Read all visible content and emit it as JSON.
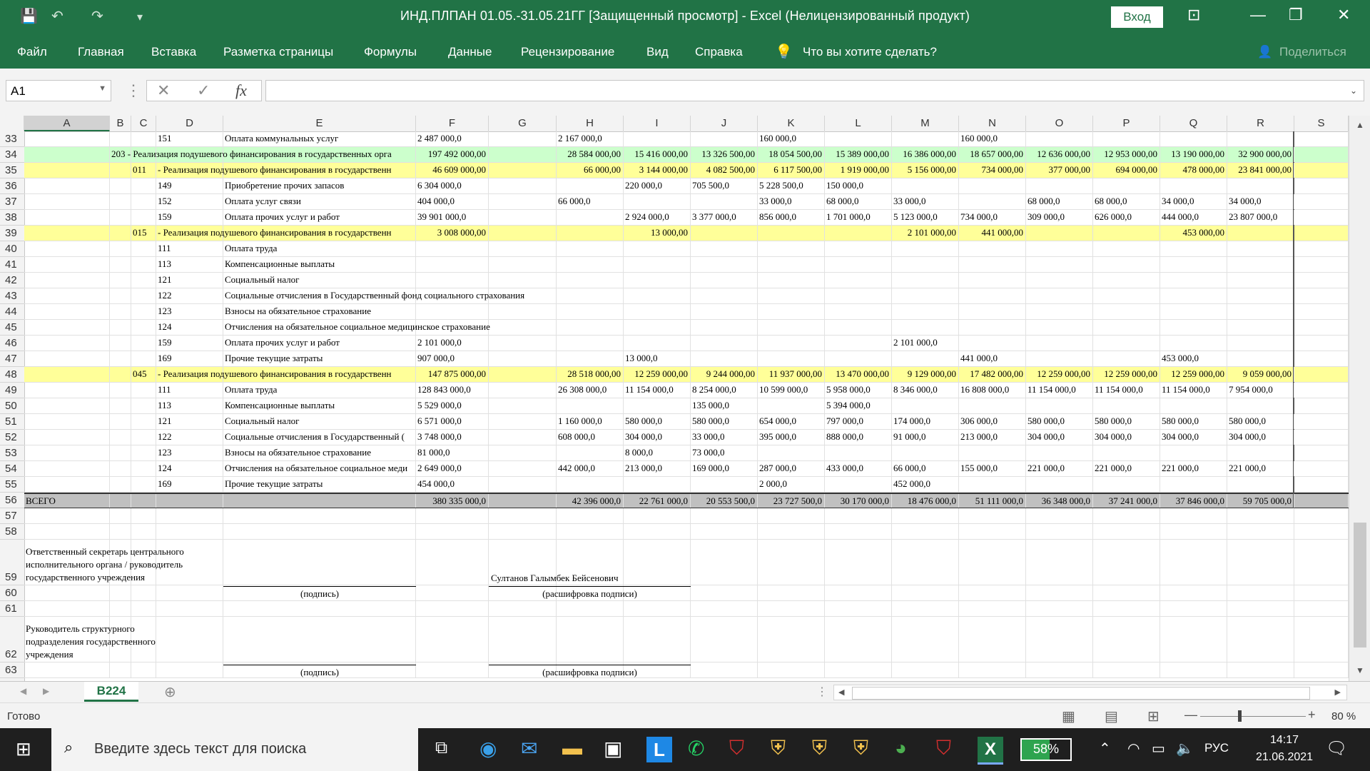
{
  "window": {
    "title": "ИНД.ПЛПАН 01.05.-31.05.21ГГ  [Защищенный просмотр]  -  Excel (Нелицензированный продукт)",
    "login_label": "Вход"
  },
  "ribbon": {
    "tabs": [
      "Файл",
      "Главная",
      "Вставка",
      "Разметка страницы",
      "Формулы",
      "Данные",
      "Рецензирование",
      "Вид",
      "Справка"
    ],
    "tell_me": "Что вы хотите сделать?",
    "share": "Поделиться"
  },
  "formula_bar": {
    "name_box": "A1",
    "fx": "fx",
    "value": ""
  },
  "columns": [
    "A",
    "B",
    "C",
    "D",
    "E",
    "F",
    "G",
    "H",
    "I",
    "J",
    "K",
    "L",
    "M",
    "N",
    "O",
    "P",
    "Q",
    "R",
    "S"
  ],
  "rows": [
    {
      "n": "33",
      "d": "151",
      "e": "Оплата коммунальных услуг",
      "f": "2 487 000,0",
      "h": "2 167 000,0",
      "k": "160 000,0",
      "n2": "160 000,0"
    },
    {
      "n": "34",
      "style": "green",
      "b": "203 - Реализация подушевого финансирования в государственных орга",
      "f": "197 492 000,00",
      "h": "28 584 000,00",
      "i": "15 416 000,00",
      "j": "13 326 500,00",
      "k": "18 054 500,00",
      "l": "15 389 000,00",
      "m": "16 386 000,00",
      "n2": "18 657 000,00",
      "o": "12 636 000,00",
      "p": "12 953 000,00",
      "q": "13 190 000,00",
      "r": "32 900 000,00"
    },
    {
      "n": "35",
      "style": "yellow",
      "c": "011",
      "d": "- Реализация подушевого финансирования в государственн",
      "f": "46 609 000,00",
      "h": "66 000,00",
      "i": "3 144 000,00",
      "j": "4 082 500,00",
      "k": "6 117 500,00",
      "l": "1 919 000,00",
      "m": "5 156 000,00",
      "n2": "734 000,00",
      "o": "377 000,00",
      "p": "694 000,00",
      "q": "478 000,00",
      "r": "23 841 000,00"
    },
    {
      "n": "36",
      "d": "149",
      "e": "Приобретение прочих запасов",
      "f": "6 304 000,0",
      "i": "220 000,0",
      "j": "705 500,0",
      "k": "5 228 500,0",
      "l": "150 000,0"
    },
    {
      "n": "37",
      "d": "152",
      "e": "Оплата услуг связи",
      "f": "404 000,0",
      "h": "66 000,0",
      "k": "33 000,0",
      "l": "68 000,0",
      "m": "33 000,0",
      "o": "68 000,0",
      "p": "68 000,0",
      "q": "34 000,0",
      "r": "34 000,0"
    },
    {
      "n": "38",
      "d": "159",
      "e": "Оплата прочих услуг и работ",
      "f": "39 901 000,0",
      "i": "2 924 000,0",
      "j": "3 377 000,0",
      "k": "856 000,0",
      "l": "1 701 000,0",
      "m": "5 123 000,0",
      "n2": "734 000,0",
      "o": "309 000,0",
      "p": "626 000,0",
      "q": "444 000,0",
      "r": "23 807 000,0"
    },
    {
      "n": "39",
      "style": "yellow",
      "c": "015",
      "d": "- Реализация подушевого финансирования в государственн",
      "f": "3 008 000,00",
      "i": "13 000,00",
      "m": "2 101 000,00",
      "n2": "441 000,00",
      "q": "453 000,00"
    },
    {
      "n": "40",
      "d": "111",
      "e": "Оплата труда"
    },
    {
      "n": "41",
      "d": "113",
      "e": "Компенсационные выплаты"
    },
    {
      "n": "42",
      "d": "121",
      "e": "Социальный налог"
    },
    {
      "n": "43",
      "d": "122",
      "e": "Социальные отчисления в Государственный фонд социального страхования"
    },
    {
      "n": "44",
      "d": "123",
      "e": "Взносы на обязательное страхование"
    },
    {
      "n": "45",
      "d": "124",
      "e": "Отчисления на обязательное социальное медицинское страхование"
    },
    {
      "n": "46",
      "d": "159",
      "e": "Оплата прочих услуг и работ",
      "f": "2 101 000,0",
      "m": "2 101 000,0"
    },
    {
      "n": "47",
      "d": "169",
      "e": "Прочие текущие затраты",
      "f": "907 000,0",
      "i": "13 000,0",
      "n2": "441 000,0",
      "q": "453 000,0"
    },
    {
      "n": "48",
      "style": "yellow",
      "c": "045",
      "d": "- Реализация подушевого финансирования в государственн",
      "f": "147 875 000,00",
      "h": "28 518 000,00",
      "i": "12 259 000,00",
      "j": "9 244 000,00",
      "k": "11 937 000,00",
      "l": "13 470 000,00",
      "m": "9 129 000,00",
      "n2": "17 482 000,00",
      "o": "12 259 000,00",
      "p": "12 259 000,00",
      "q": "12 259 000,00",
      "r": "9 059 000,00"
    },
    {
      "n": "49",
      "d": "111",
      "e": "Оплата труда",
      "f": "128 843 000,0",
      "h": "26 308 000,0",
      "i": "11 154 000,0",
      "j": "8 254 000,0",
      "k": "10 599 000,0",
      "l": "5 958 000,0",
      "m": "8 346 000,0",
      "n2": "16 808 000,0",
      "o": "11 154 000,0",
      "p": "11 154 000,0",
      "q": "11 154 000,0",
      "r": "7 954 000,0"
    },
    {
      "n": "50",
      "d": "113",
      "e": "Компенсационные выплаты",
      "f": "5 529 000,0",
      "j": "135 000,0",
      "l": "5 394 000,0"
    },
    {
      "n": "51",
      "d": "121",
      "e": "Социальный налог",
      "f": "6 571 000,0",
      "h": "1 160 000,0",
      "i": "580 000,0",
      "j": "580 000,0",
      "k": "654 000,0",
      "l": "797 000,0",
      "m": "174 000,0",
      "n2": "306 000,0",
      "o": "580 000,0",
      "p": "580 000,0",
      "q": "580 000,0",
      "r": "580 000,0"
    },
    {
      "n": "52",
      "d": "122",
      "e": "Социальные отчисления в Государственный (",
      "f": "3 748 000,0",
      "h": "608 000,0",
      "i": "304 000,0",
      "j": "33 000,0",
      "k": "395 000,0",
      "l": "888 000,0",
      "m": "91 000,0",
      "n2": "213 000,0",
      "o": "304 000,0",
      "p": "304 000,0",
      "q": "304 000,0",
      "r": "304 000,0"
    },
    {
      "n": "53",
      "d": "123",
      "e": "Взносы на обязательное страхование",
      "f": "81 000,0",
      "i": "8 000,0",
      "j": "73 000,0"
    },
    {
      "n": "54",
      "d": "124",
      "e": "Отчисления на обязательное социальное меди",
      "f": "2 649 000,0",
      "h": "442 000,0",
      "i": "213 000,0",
      "j": "169 000,0",
      "k": "287 000,0",
      "l": "433 000,0",
      "m": "66 000,0",
      "n2": "155 000,0",
      "o": "221 000,0",
      "p": "221 000,0",
      "q": "221 000,0",
      "r": "221 000,0"
    },
    {
      "n": "55",
      "d": "169",
      "e": "Прочие текущие затраты",
      "f": "454 000,0",
      "k": "2 000,0",
      "m": "452 000,0"
    },
    {
      "n": "56",
      "style": "gray",
      "a": "ВСЕГО",
      "f": "380 335 000,0",
      "h": "42 396 000,0",
      "i": "22 761 000,0",
      "j": "20 553 500,0",
      "k": "23 727 500,0",
      "l": "30 170 000,0",
      "m": "18 476 000,0",
      "n2": "51 111 000,0",
      "o": "36 348 000,0",
      "p": "37 241 000,0",
      "q": "37 846 000,0",
      "r": "59 705 000,0"
    }
  ],
  "signatures": {
    "sig1_title_1": "Ответственный секретарь центрального",
    "sig1_title_2": "исполнительного органа / руководитель",
    "sig1_title_3": "государственного учреждения",
    "sig1_name": "Султанов Галымбек Бейсенович",
    "sig_caption": "(подпись)",
    "name_caption": "(расшифровка подписи)",
    "sig2_title_1": "Руководитель структурного",
    "sig2_title_2": "подразделения государственного",
    "sig2_title_3": "учреждения"
  },
  "extra_rows": [
    "57",
    "58",
    "59",
    "60",
    "61",
    "62",
    "63"
  ],
  "sheet_tabs": {
    "active": "B224"
  },
  "status": {
    "ready": "Готово",
    "zoom": "80 %"
  },
  "taskbar": {
    "search_placeholder": "Введите здесь текст для поиска",
    "battery": "58%",
    "lang": "РУС",
    "time": "14:17",
    "date": "21.06.2021"
  },
  "colors": {
    "excel_green": "#217346",
    "row_green": "#ccffcc",
    "row_yellow": "#ffff99",
    "row_gray": "#c0c0c0"
  }
}
